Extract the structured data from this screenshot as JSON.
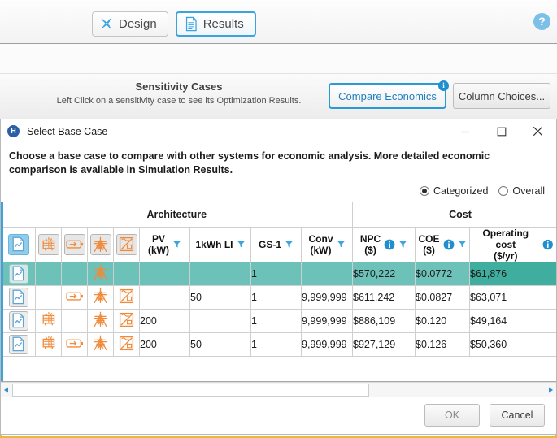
{
  "app": {
    "tabs": [
      {
        "label": "Design",
        "icon": "design-icon",
        "active": false
      },
      {
        "label": "Results",
        "icon": "results-document-icon",
        "active": true
      }
    ],
    "help_label": "?",
    "sensitivity": {
      "title": "Sensitivity Cases",
      "subtitle": "Left Click on a sensitivity case to see its Optimization Results."
    },
    "compare_economics_label": "Compare Economics",
    "compare_economics_info": "i",
    "column_choices_label": "Column Choices..."
  },
  "dialog": {
    "app_icon_text": "H",
    "title": "Select Base Case",
    "window_buttons": {
      "minimize": "minimize-icon",
      "maximize": "maximize-icon",
      "close": "close-icon"
    },
    "instructions": "Choose a base case to compare with other systems for economic analysis. More detailed economic comparison is available in Simulation Results.",
    "view_modes": [
      {
        "label": "Categorized",
        "selected": true
      },
      {
        "label": "Overall",
        "selected": false
      }
    ],
    "footer": {
      "ok_label": "OK",
      "cancel_label": "Cancel"
    },
    "scrollbar": {
      "left_arrow": "scroll-left-icon",
      "right_arrow": "scroll-right-icon"
    }
  },
  "table": {
    "group_headers": [
      {
        "label": "Architecture",
        "span": 9
      },
      {
        "label": "Cost",
        "span": 3
      }
    ],
    "columns": [
      {
        "key": "select",
        "label": "",
        "unit": "",
        "icon": "report-document-icon",
        "filter": false,
        "info": false,
        "selected_header": true
      },
      {
        "key": "pv_ico",
        "label": "",
        "unit": "",
        "icon": "solar-panel-icon",
        "filter": false,
        "info": false
      },
      {
        "key": "bat_ico",
        "label": "",
        "unit": "",
        "icon": "battery-icon",
        "filter": false,
        "info": false
      },
      {
        "key": "gen_ico",
        "label": "",
        "unit": "",
        "icon": "grid-tower-icon",
        "filter": false,
        "info": false
      },
      {
        "key": "conv_ico",
        "label": "",
        "unit": "",
        "icon": "converter-icon",
        "filter": false,
        "info": false
      },
      {
        "key": "pv",
        "label": "PV",
        "unit": "(kW)",
        "icon": "",
        "filter": true,
        "info": false
      },
      {
        "key": "li",
        "label": "1kWh LI",
        "unit": "",
        "icon": "",
        "filter": true,
        "info": false
      },
      {
        "key": "gs1",
        "label": "GS-1",
        "unit": "",
        "icon": "",
        "filter": true,
        "info": false
      },
      {
        "key": "conv",
        "label": "Conv",
        "unit": "(kW)",
        "icon": "",
        "filter": true,
        "info": false
      },
      {
        "key": "npc",
        "label": "NPC",
        "unit": "($)",
        "icon": "",
        "filter": true,
        "info": true
      },
      {
        "key": "coe",
        "label": "COE",
        "unit": "($)",
        "icon": "",
        "filter": true,
        "info": true
      },
      {
        "key": "opcost",
        "label": "Operating cost",
        "unit": "($/yr)",
        "icon": "",
        "filter": true,
        "info": true
      }
    ],
    "rows": [
      {
        "selected": true,
        "accent_cell": "opcost",
        "icons": {
          "pv": false,
          "bat": false,
          "gen": true,
          "conv": false
        },
        "pv": "",
        "li": "",
        "gs1": "1",
        "conv": "",
        "npc": "$570,222",
        "coe": "$0.0772",
        "opcost": "$61,876"
      },
      {
        "selected": false,
        "accent_cell": "",
        "icons": {
          "pv": false,
          "bat": true,
          "gen": true,
          "conv": true
        },
        "pv": "",
        "li": "50",
        "gs1": "1",
        "conv": "9,999,999",
        "npc": "$611,242",
        "coe": "$0.0827",
        "opcost": "$63,071"
      },
      {
        "selected": false,
        "accent_cell": "",
        "icons": {
          "pv": true,
          "bat": false,
          "gen": true,
          "conv": true
        },
        "pv": "200",
        "li": "",
        "gs1": "1",
        "conv": "9,999,999",
        "npc": "$886,109",
        "coe": "$0.120",
        "opcost": "$49,164"
      },
      {
        "selected": false,
        "accent_cell": "",
        "icons": {
          "pv": true,
          "bat": true,
          "gen": true,
          "conv": true
        },
        "pv": "200",
        "li": "50",
        "gs1": "1",
        "conv": "9,999,999",
        "npc": "$927,129",
        "coe": "$0.126",
        "opcost": "$50,360"
      }
    ]
  },
  "colors": {
    "accent_blue": "#3ba3dd",
    "selection_teal": "#6cc1b9",
    "selection_teal_dark": "#3fae9f",
    "icon_orange": "#f08b3c",
    "window_border_yellow": "#e8b93a",
    "info_blue": "#1f8fd0"
  }
}
